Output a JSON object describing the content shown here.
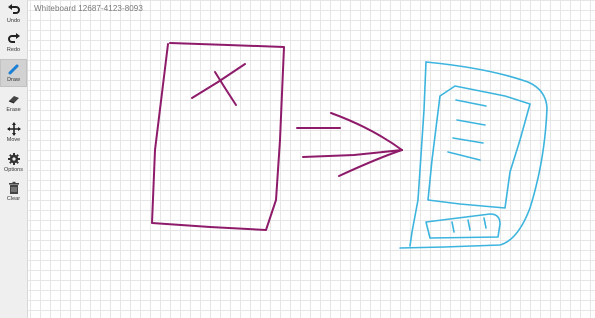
{
  "board": {
    "title": "Whiteboard 12687-4123-8093"
  },
  "toolbar": {
    "tools": [
      {
        "label": "Undo",
        "icon": "undo-icon"
      },
      {
        "label": "Redo",
        "icon": "redo-icon"
      },
      {
        "label": "Draw",
        "icon": "pencil-icon",
        "active": true
      },
      {
        "label": "Erase",
        "icon": "eraser-icon"
      },
      {
        "label": "Move",
        "icon": "move-arrows-icon"
      },
      {
        "label": "Options",
        "icon": "gear-icon"
      },
      {
        "label": "Clear",
        "icon": "trash-icon"
      }
    ]
  },
  "colors": {
    "stroke_magenta": "#8e1b6a",
    "stroke_cyan": "#3cb4de",
    "draw_active": "#1c7fd6",
    "grid": "#e6e6e6"
  }
}
